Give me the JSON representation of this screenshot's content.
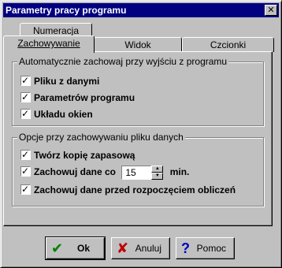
{
  "window": {
    "title": "Parametry pracy programu",
    "close_label": "✕"
  },
  "tabs": {
    "back_row": [
      {
        "label": "Numeracja"
      }
    ],
    "front_row": [
      {
        "label": "Zachowywanie",
        "active": true
      },
      {
        "label": "Widok"
      },
      {
        "label": "Czcionki"
      }
    ]
  },
  "groups": {
    "autosave": {
      "title": "Automatycznie zachowaj przy wyjściu z programu",
      "items": [
        {
          "label": "Pliku z danymi",
          "checked": true
        },
        {
          "label": "Parametrów programu",
          "checked": true
        },
        {
          "label": "Układu okien",
          "checked": true
        }
      ]
    },
    "save_options": {
      "title": "Opcje przy zachowywaniu pliku danych",
      "backup_label": "Twórz kopię zapasową",
      "interval_prefix": "Zachowuj dane co",
      "interval_value": "15",
      "interval_unit": "min.",
      "before_calc_label": "Zachowuj dane przed rozpoczęciem obliczeń"
    }
  },
  "buttons": {
    "ok": {
      "label": "Ok",
      "icon": "check-icon",
      "color": "#008000"
    },
    "cancel": {
      "label": "Anuluj",
      "icon": "x-icon",
      "color": "#c00000"
    },
    "help": {
      "label": "Pomoc",
      "icon": "question-icon",
      "color": "#0000c0"
    }
  }
}
